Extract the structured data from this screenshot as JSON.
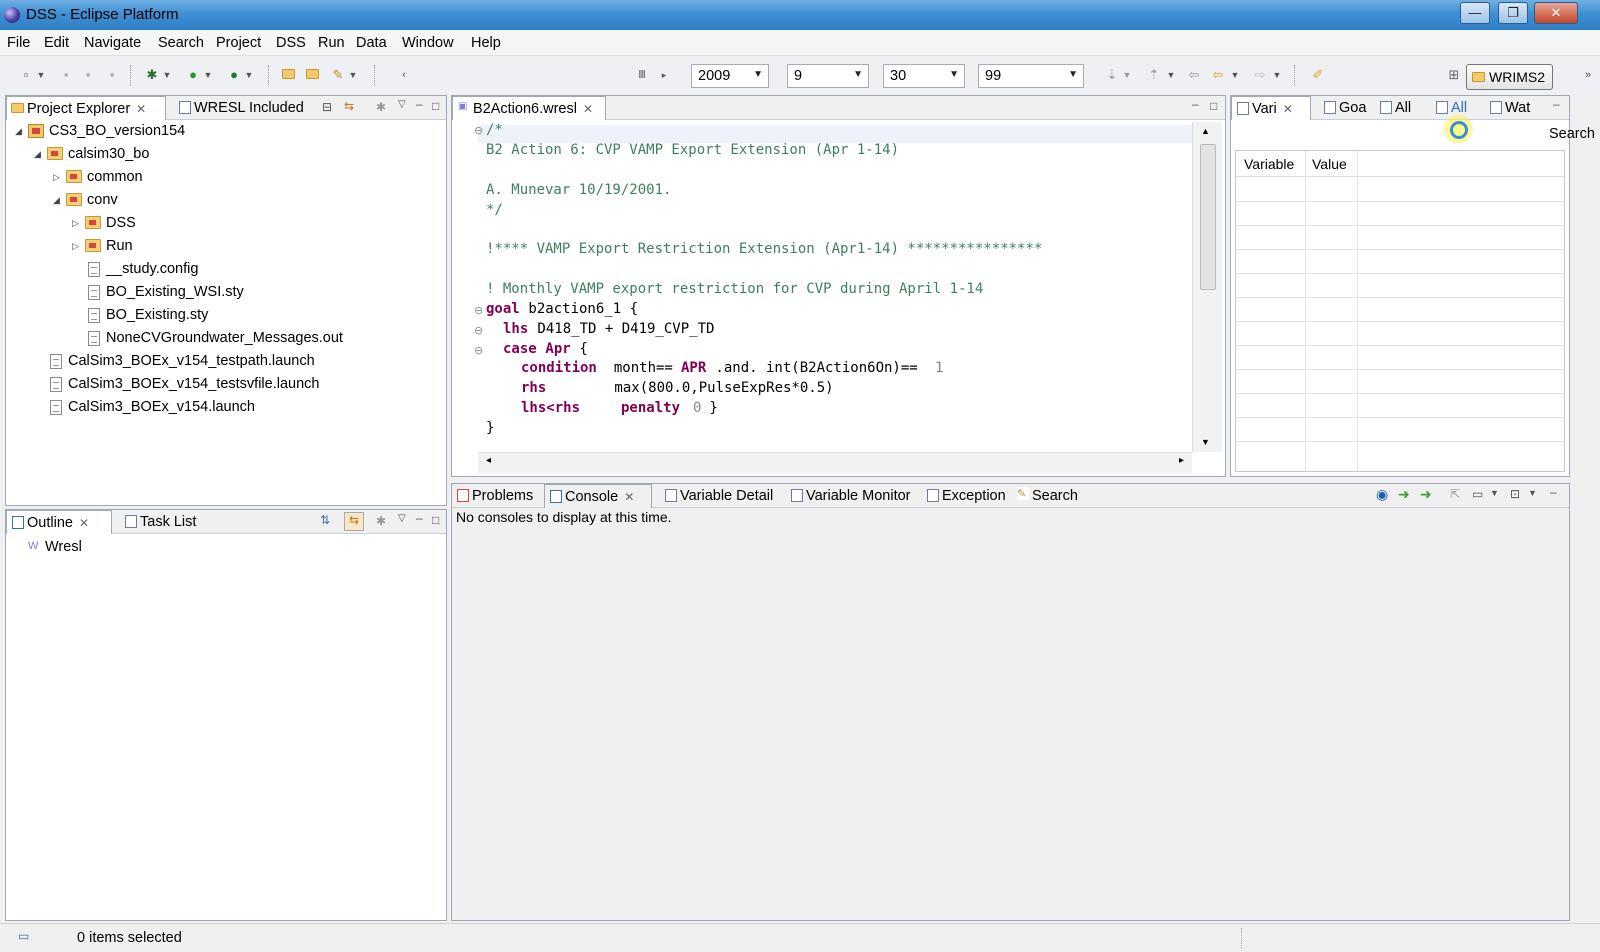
{
  "window": {
    "title": "DSS - Eclipse Platform",
    "minimize": "—",
    "maximize": "❐",
    "close": "✕"
  },
  "menu": [
    "File",
    "Edit",
    "Navigate",
    "Search",
    "Project",
    "DSS",
    "Run",
    "Data",
    "Window",
    "Help"
  ],
  "toolbar": {
    "year": "2009",
    "month": "9",
    "day": "30",
    "cycle": "99",
    "perspective": "WRIMS2"
  },
  "project_explorer": {
    "tabs": [
      "Project Explorer",
      "WRESL Included"
    ],
    "tree": [
      {
        "label": "CS3_BO_version154",
        "type": "project"
      },
      {
        "label": "calsim30_bo",
        "type": "folder"
      },
      {
        "label": "common",
        "type": "folder"
      },
      {
        "label": "conv",
        "type": "folder"
      },
      {
        "label": "DSS",
        "type": "folder"
      },
      {
        "label": "Run",
        "type": "folder"
      },
      {
        "label": "__study.config",
        "type": "file"
      },
      {
        "label": "BO_Existing_WSI.sty",
        "type": "file"
      },
      {
        "label": "BO_Existing.sty",
        "type": "file"
      },
      {
        "label": "NoneCVGroundwater_Messages.out",
        "type": "file"
      },
      {
        "label": "CalSim3_BOEx_v154_testpath.launch",
        "type": "file"
      },
      {
        "label": "CalSim3_BOEx_v154_testsvfile.launch",
        "type": "file"
      },
      {
        "label": "CalSim3_BOEx_v154.launch",
        "type": "file"
      }
    ]
  },
  "outline": {
    "tabs": [
      "Outline",
      "Task List"
    ],
    "item": "Wresl",
    "item_icon": "W"
  },
  "editor": {
    "tab": "B2Action6.wresl",
    "lines": {
      "l1": "/*",
      "l2": "B2 Action 6: CVP VAMP Export Extension (Apr 1-14)",
      "l3": "A. Munevar 10/19/2001.",
      "l4": "*/",
      "l5": "!**** VAMP Export Restriction Extension (Apr1-14) ****************",
      "l6": "! Monthly VAMP export restriction for CVP during April 1-14",
      "goal_kw": "goal",
      "goal_rest": " b2action6_1 {",
      "lhs_kw": "lhs",
      "lhs_rest": " D418_TD + D419_CVP_TD",
      "case_kw": "case",
      "case_name": " Apr",
      "case_rest": " {",
      "cond_kw": "condition",
      "cond_a": "  month==",
      "cond_apr": "APR",
      "cond_b": " .and. int(B2Action6On)==",
      "cond_num": "1",
      "rhs_kw": "rhs",
      "rhs_rest": "        max(800.0,PulseExpRes*0.5)",
      "lhsrhs_kw": "lhs<rhs",
      "penalty_kw": "penalty",
      "penalty_num": "0",
      "penalty_end": " }",
      "close1": "}"
    }
  },
  "right_panel": {
    "tabs": [
      "Vari",
      "Goa",
      "All",
      "All",
      "Wat"
    ],
    "search_label": "Search",
    "columns": [
      "Variable",
      "Value"
    ]
  },
  "console": {
    "tabs": [
      "Problems",
      "Console",
      "Variable Detail",
      "Variable Monitor",
      "Exception",
      "Search"
    ],
    "message": "No consoles to display at this time."
  },
  "status": {
    "text": "0 items selected"
  },
  "colors": {
    "comment": "#3f7f5f",
    "keyword": "#7f0055",
    "titlebar": "#3f8fd2"
  }
}
